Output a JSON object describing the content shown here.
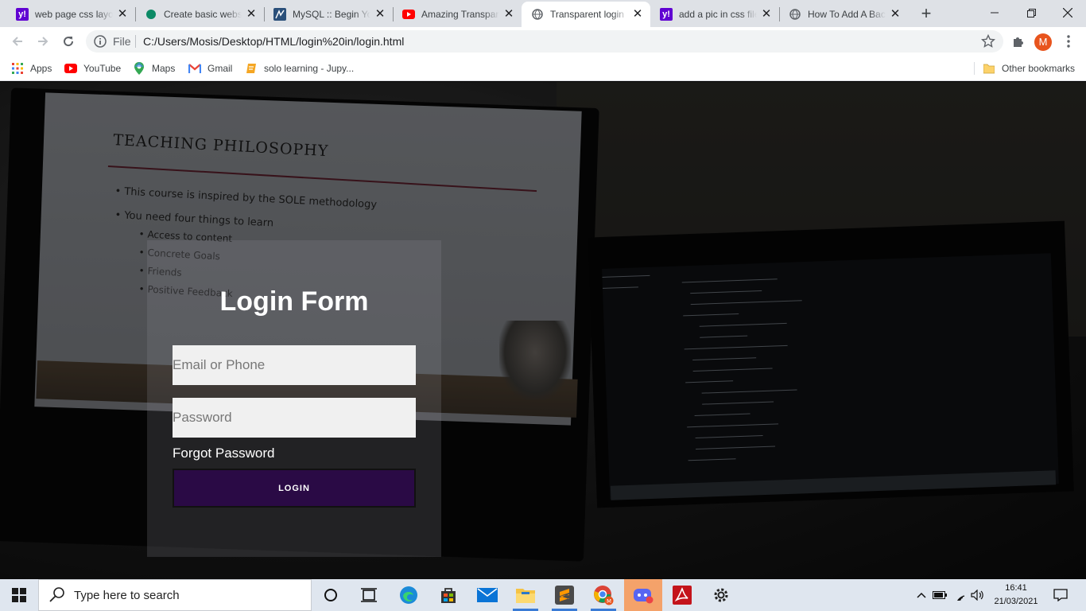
{
  "browser": {
    "tabs": [
      {
        "title": "web page css layout",
        "favicon": "yahoo-icon",
        "active": false
      },
      {
        "title": "Create basic website",
        "favicon": "green-dot-icon",
        "active": false
      },
      {
        "title": "MySQL :: Begin Your",
        "favicon": "mysql-icon",
        "active": false
      },
      {
        "title": "Amazing Transparent",
        "favicon": "youtube-icon",
        "active": false
      },
      {
        "title": "Transparent login",
        "favicon": "globe-icon",
        "active": true
      },
      {
        "title": "add a pic in css file",
        "favicon": "yahoo-icon",
        "active": false
      },
      {
        "title": "How To Add A Backg",
        "favicon": "globe-icon",
        "active": false
      }
    ],
    "new_tab_icon": "plus-icon",
    "address": {
      "scheme_label": "File",
      "url": "C:/Users/Mosis/Desktop/HTML/login%20in/login.html"
    },
    "profile_initial": "M",
    "bookmarks": [
      {
        "label": "Apps",
        "icon": "apps-grid-icon"
      },
      {
        "label": "YouTube",
        "icon": "youtube-icon"
      },
      {
        "label": "Maps",
        "icon": "maps-icon"
      },
      {
        "label": "Gmail",
        "icon": "gmail-icon"
      },
      {
        "label": "solo learning - Jupy...",
        "icon": "notebook-icon"
      }
    ],
    "other_bookmarks": "Other bookmarks"
  },
  "background_slide": {
    "title": "TEACHING PHILOSOPHY",
    "bullets": [
      "This course is inspired by the SOLE methodology",
      "You need four things to learn",
      "Access to content",
      "Concrete Goals",
      "Friends",
      "Positive Feedback"
    ]
  },
  "login": {
    "title": "Login Form",
    "email_placeholder": "Email or Phone",
    "password_placeholder": "Password",
    "forgot_label": "Forgot Password",
    "button_label": "LOGIN"
  },
  "taskbar": {
    "search_placeholder": "Type here to search",
    "time": "16:41",
    "date": "21/03/2021",
    "pinned": [
      "cortana-icon",
      "task-view-icon",
      "edge-icon",
      "store-icon",
      "mail-icon",
      "file-explorer-icon",
      "sublime-icon",
      "chrome-icon",
      "discord-icon",
      "acrobat-icon",
      "settings-icon"
    ]
  },
  "colors": {
    "tab_strip": "#dee1e6",
    "login_button": "#2a0a45",
    "taskbar": "#dfe6ef",
    "profile": "#e8541d"
  }
}
